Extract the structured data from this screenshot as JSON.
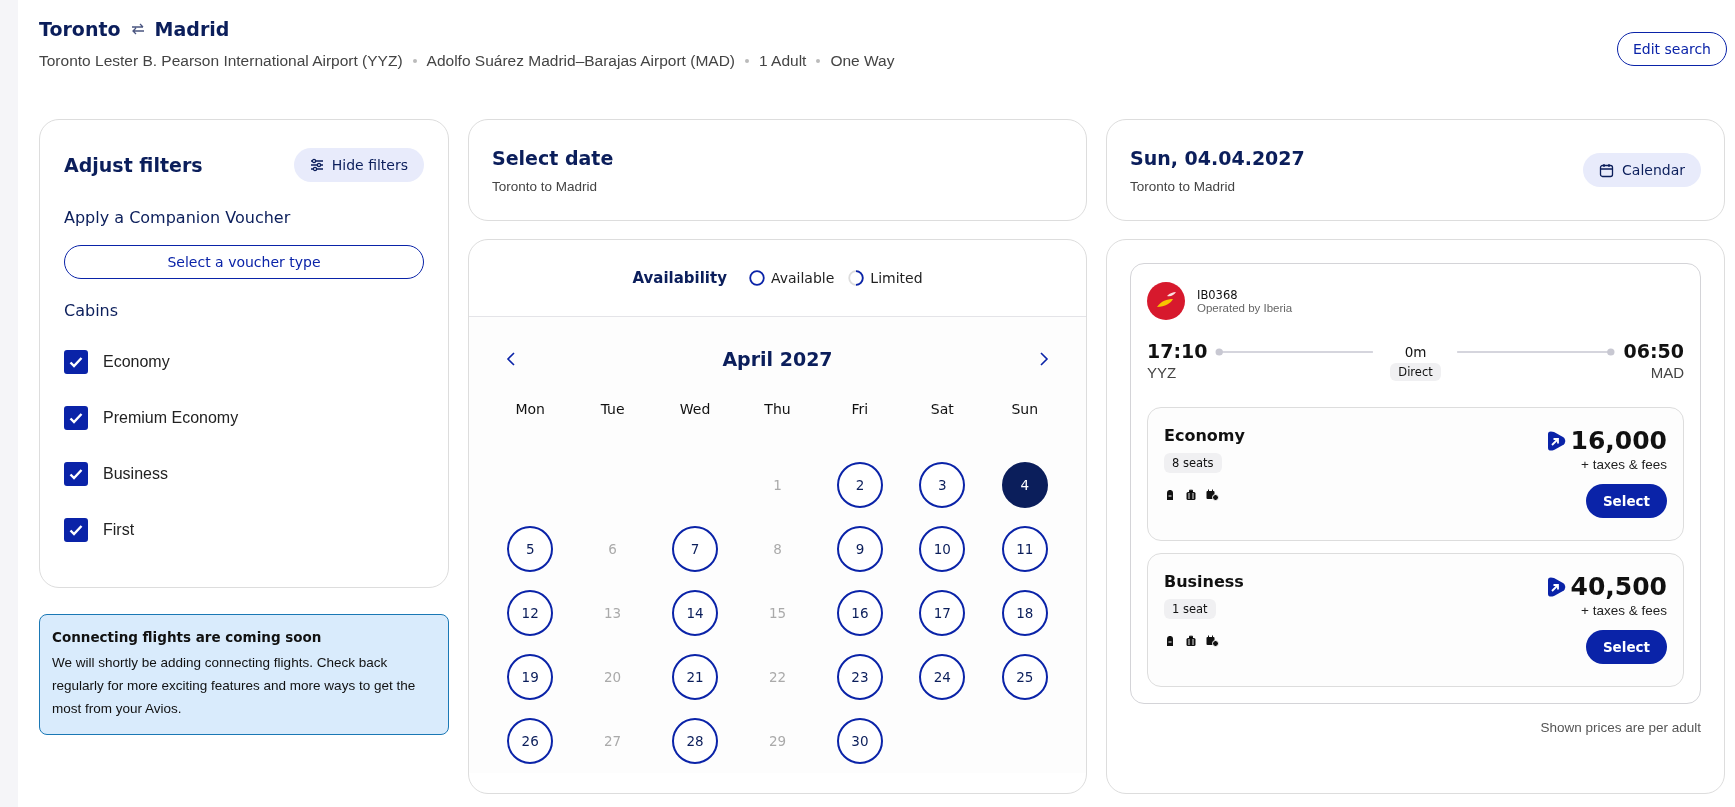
{
  "header": {
    "origin": "Toronto",
    "destination": "Madrid",
    "details": [
      "Toronto Lester B. Pearson International Airport (YYZ)",
      "Adolfo Suárez Madrid–Barajas Airport (MAD)",
      "1 Adult",
      "One Way"
    ],
    "edit_button": "Edit search"
  },
  "filters": {
    "title": "Adjust filters",
    "hide_button": "Hide filters",
    "voucher_heading": "Apply a Companion Voucher",
    "voucher_button": "Select a voucher type",
    "cabins_heading": "Cabins",
    "cabins": [
      {
        "label": "Economy",
        "checked": true
      },
      {
        "label": "Premium Economy",
        "checked": true
      },
      {
        "label": "Business",
        "checked": true
      },
      {
        "label": "First",
        "checked": true
      }
    ]
  },
  "notice": {
    "title": "Connecting flights are coming soon",
    "text": "We will shortly be adding connecting flights. Check back regularly for more exciting features and more ways to get the most from your Avios."
  },
  "date_card": {
    "title": "Select date",
    "subtitle": "Toronto to Madrid"
  },
  "calendar": {
    "legend_title": "Availability",
    "legend": [
      {
        "label": "Available",
        "kind": "available"
      },
      {
        "label": "Limited",
        "kind": "limited"
      }
    ],
    "month": "April 2027",
    "weekdays": [
      "Mon",
      "Tue",
      "Wed",
      "Thu",
      "Fri",
      "Sat",
      "Sun"
    ],
    "days": [
      {
        "kind": "blank"
      },
      {
        "kind": "blank"
      },
      {
        "kind": "blank"
      },
      {
        "day": "1",
        "kind": "unavailable",
        "selected": false
      },
      {
        "day": "2",
        "kind": "available",
        "selected": false
      },
      {
        "day": "3",
        "kind": "available",
        "selected": false
      },
      {
        "day": "4",
        "kind": "available",
        "selected": true
      },
      {
        "day": "5",
        "kind": "available",
        "selected": false
      },
      {
        "day": "6",
        "kind": "unavailable",
        "selected": false
      },
      {
        "day": "7",
        "kind": "available",
        "selected": false
      },
      {
        "day": "8",
        "kind": "unavailable",
        "selected": false
      },
      {
        "day": "9",
        "kind": "available",
        "selected": false
      },
      {
        "day": "10",
        "kind": "available",
        "selected": false
      },
      {
        "day": "11",
        "kind": "available",
        "selected": false
      },
      {
        "day": "12",
        "kind": "available",
        "selected": false
      },
      {
        "day": "13",
        "kind": "unavailable",
        "selected": false
      },
      {
        "day": "14",
        "kind": "available",
        "selected": false
      },
      {
        "day": "15",
        "kind": "unavailable",
        "selected": false
      },
      {
        "day": "16",
        "kind": "available",
        "selected": false
      },
      {
        "day": "17",
        "kind": "available",
        "selected": false
      },
      {
        "day": "18",
        "kind": "available",
        "selected": false
      },
      {
        "day": "19",
        "kind": "available",
        "selected": false
      },
      {
        "day": "20",
        "kind": "unavailable",
        "selected": false
      },
      {
        "day": "21",
        "kind": "available",
        "selected": false
      },
      {
        "day": "22",
        "kind": "unavailable",
        "selected": false
      },
      {
        "day": "23",
        "kind": "available",
        "selected": false
      },
      {
        "day": "24",
        "kind": "available",
        "selected": false
      },
      {
        "day": "25",
        "kind": "available",
        "selected": false
      },
      {
        "day": "26",
        "kind": "available",
        "selected": false
      },
      {
        "day": "27",
        "kind": "unavailable",
        "selected": false
      },
      {
        "day": "28",
        "kind": "available",
        "selected": false
      },
      {
        "day": "29",
        "kind": "unavailable",
        "selected": false
      },
      {
        "day": "30",
        "kind": "available",
        "selected": false
      }
    ]
  },
  "flight_header": {
    "title": "Sun, 04.04.2027",
    "subtitle": "Toronto to Madrid",
    "calendar_button": "Calendar"
  },
  "flight": {
    "number": "IB0368",
    "operator": "Operated by Iberia",
    "departure_time": "17:10",
    "departure_code": "YYZ",
    "duration": "0m",
    "stops": "Direct",
    "arrival_time": "06:50",
    "arrival_code": "MAD",
    "fares": [
      {
        "cabin": "Economy",
        "seats": "8 seats",
        "price": "16,000",
        "taxes": "+ taxes & fees",
        "button": "Select"
      },
      {
        "cabin": "Business",
        "seats": "1 seat",
        "price": "40,500",
        "taxes": "+ taxes & fees",
        "button": "Select"
      }
    ]
  },
  "footnote": "Shown prices are per adult"
}
